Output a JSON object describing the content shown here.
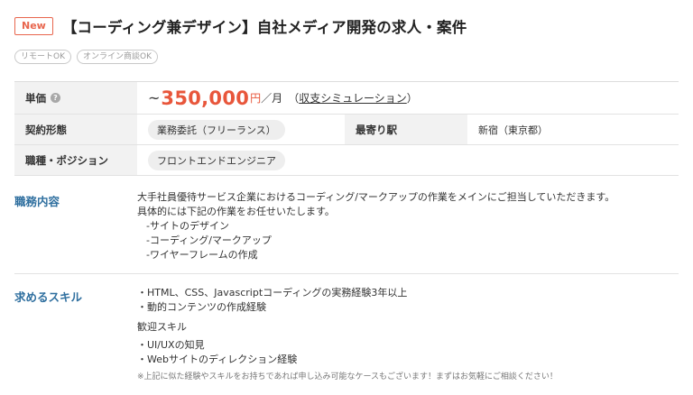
{
  "header": {
    "badge": "New",
    "title": "【コーディング兼デザイン】自社メディア開発の求人・案件"
  },
  "tags": [
    "リモートOK",
    "オンライン商談OK"
  ],
  "info": {
    "unit_price": {
      "label": "単価",
      "tilde": "~",
      "amount": "350,000",
      "yen": "円",
      "per_month": "／月",
      "sim_open": "（",
      "sim_link": "収支シミュレーション",
      "sim_close": "）"
    },
    "contract": {
      "label": "契約形態",
      "value": "業務委託（フリーランス）"
    },
    "station": {
      "label": "最寄り駅",
      "value": "新宿（東京都）"
    },
    "position": {
      "label": "職種・ポジション",
      "value": "フロントエンドエンジニア"
    }
  },
  "duties": {
    "label": "職務内容",
    "lines": [
      "大手社員優待サービス企業におけるコーディング/マークアップの作業をメインにご担当していただきます。",
      "具体的には下記の作業をお任せいたします。",
      "-サイトのデザイン",
      "-コーディング/マークアップ",
      "-ワイヤーフレームの作成"
    ]
  },
  "skills": {
    "label": "求めるスキル",
    "required": [
      "・HTML、CSS、Javascriptコーディングの実務経験3年以上",
      "・動的コンテンツの作成経験"
    ],
    "welcome_heading": "歓迎スキル",
    "welcome": [
      "・UI/UXの知見",
      "・Webサイトのディレクション経験"
    ],
    "note": "※上記に似た経験やスキルをお持ちであれば申し込み可能なケースもございます！まずはお気軽にご相談ください！"
  }
}
